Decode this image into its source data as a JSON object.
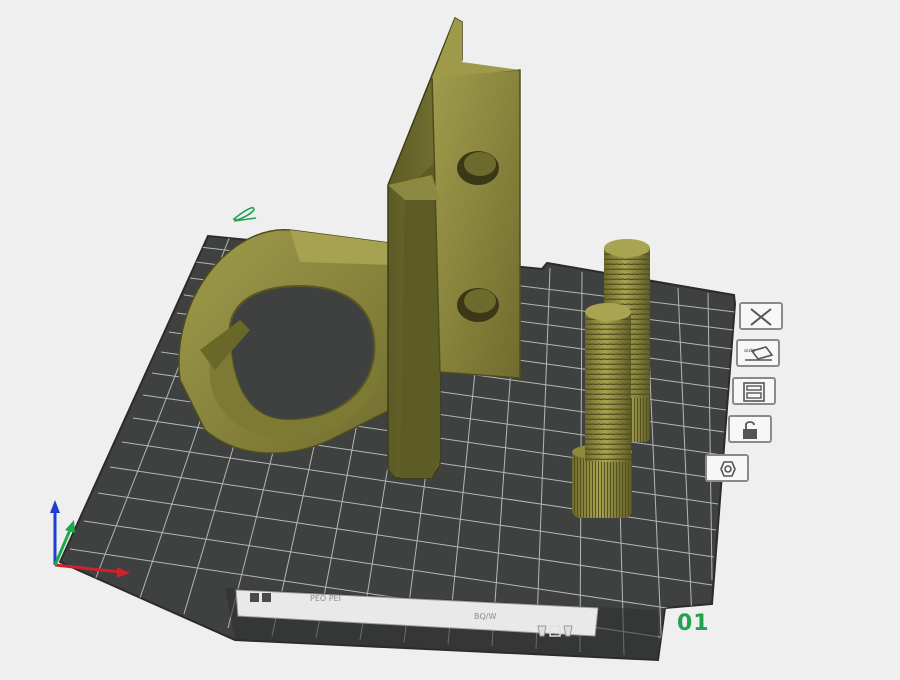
{
  "plate": {
    "number_label": "01"
  },
  "bed_footer": {
    "left_text": "PEO PEI",
    "right_text": "BQ/W"
  },
  "side_tools": [
    {
      "name": "close-plate-button",
      "icon": "close-icon"
    },
    {
      "name": "auto-orient-button",
      "icon": "auto-orient-icon"
    },
    {
      "name": "arrange-button",
      "icon": "arrange-icon"
    },
    {
      "name": "lock-plate-button",
      "icon": "lock-icon"
    },
    {
      "name": "plate-settings-button",
      "icon": "settings-hex-icon"
    }
  ],
  "colors": {
    "background": "#efefef",
    "bed": "#3f4140",
    "grid": "#cfd1cf",
    "model": "#8d8a3e",
    "plate_label": "#1fa34f",
    "axis_x": "#d0212a",
    "axis_y": "#1ea84b",
    "axis_z": "#1f3fcf"
  }
}
